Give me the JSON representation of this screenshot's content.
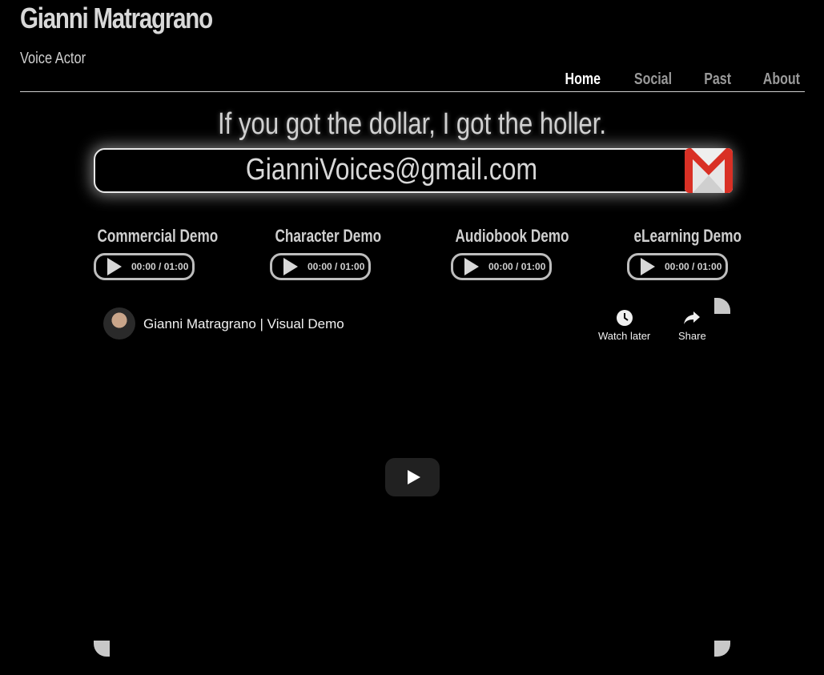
{
  "header": {
    "title": "Gianni Matragrano",
    "subtitle": "Voice Actor"
  },
  "nav": {
    "items": [
      {
        "label": "Home",
        "active": true
      },
      {
        "label": "Social",
        "active": false
      },
      {
        "label": "Past",
        "active": false
      },
      {
        "label": "About",
        "active": false
      }
    ]
  },
  "tagline": "If you got the dollar, I got the holler.",
  "contact": {
    "email": "GianniVoices@gmail.com",
    "icon": "gmail-icon"
  },
  "demos": [
    {
      "title": "Commercial Demo",
      "time": "00:00 / 01:00"
    },
    {
      "title": "Character Demo",
      "time": "00:00 / 01:00"
    },
    {
      "title": "Audiobook Demo",
      "time": "00:00 / 01:00"
    },
    {
      "title": "eLearning Demo",
      "time": "00:00 / 01:00"
    }
  ],
  "video": {
    "title": "Gianni Matragrano | Visual Demo",
    "watch_later_label": "Watch later",
    "share_label": "Share"
  },
  "colors": {
    "background": "#000000",
    "text": "#d8d8d8",
    "nav_active": "#ffffff",
    "nav_inactive": "#9a9a9a",
    "gmail_red": "#d93025"
  }
}
